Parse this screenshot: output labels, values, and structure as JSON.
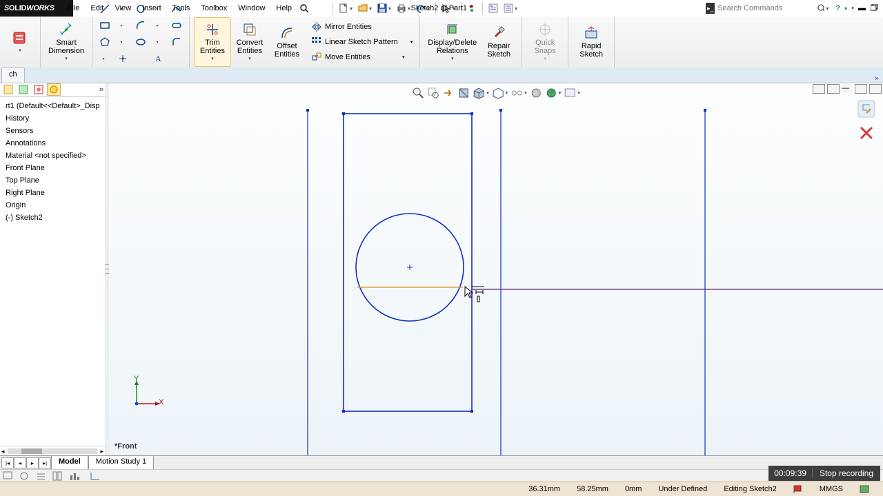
{
  "app_name_part1": "S",
  "app_name_part2": "OLID",
  "app_name_part3": "WORKS",
  "menu": [
    "File",
    "Edit",
    "View",
    "Insert",
    "Tools",
    "Toolbox",
    "Window",
    "Help"
  ],
  "document_title": "Sketch2 of Part1 *",
  "search_placeholder": "Search Commands",
  "ribbon": {
    "sketch_tab": "ch",
    "smart_dimension": "Smart\nDimension",
    "trim": "Trim\nEntities",
    "convert": "Convert\nEntities",
    "offset": "Offset\nEntities",
    "mirror": "Mirror Entities",
    "linear_pattern": "Linear Sketch Pattern",
    "move": "Move Entities",
    "display_relations": "Display/Delete\nRelations",
    "repair": "Repair\nSketch",
    "quick_snaps": "Quick\nSnaps",
    "rapid": "Rapid\nSketch"
  },
  "tree": {
    "root": "rt1  (Default<<Default>_Disp",
    "items": [
      "History",
      "Sensors",
      "Annotations",
      "Material <not specified>",
      "Front Plane",
      "Top Plane",
      "Right Plane",
      "Origin",
      "(-) Sketch2"
    ]
  },
  "view_name": "*Front",
  "triad": {
    "x": "X",
    "y": "Y"
  },
  "bottom_tabs": {
    "model": "Model",
    "motion": "Motion Study 1"
  },
  "status": {
    "x": "36.31mm",
    "y": "58.25mm",
    "z": "0mm",
    "defined": "Under Defined",
    "editing": "Editing Sketch2",
    "units": "MMGS"
  },
  "recorder": {
    "time": "00:09:39",
    "label": "Stop recording"
  }
}
